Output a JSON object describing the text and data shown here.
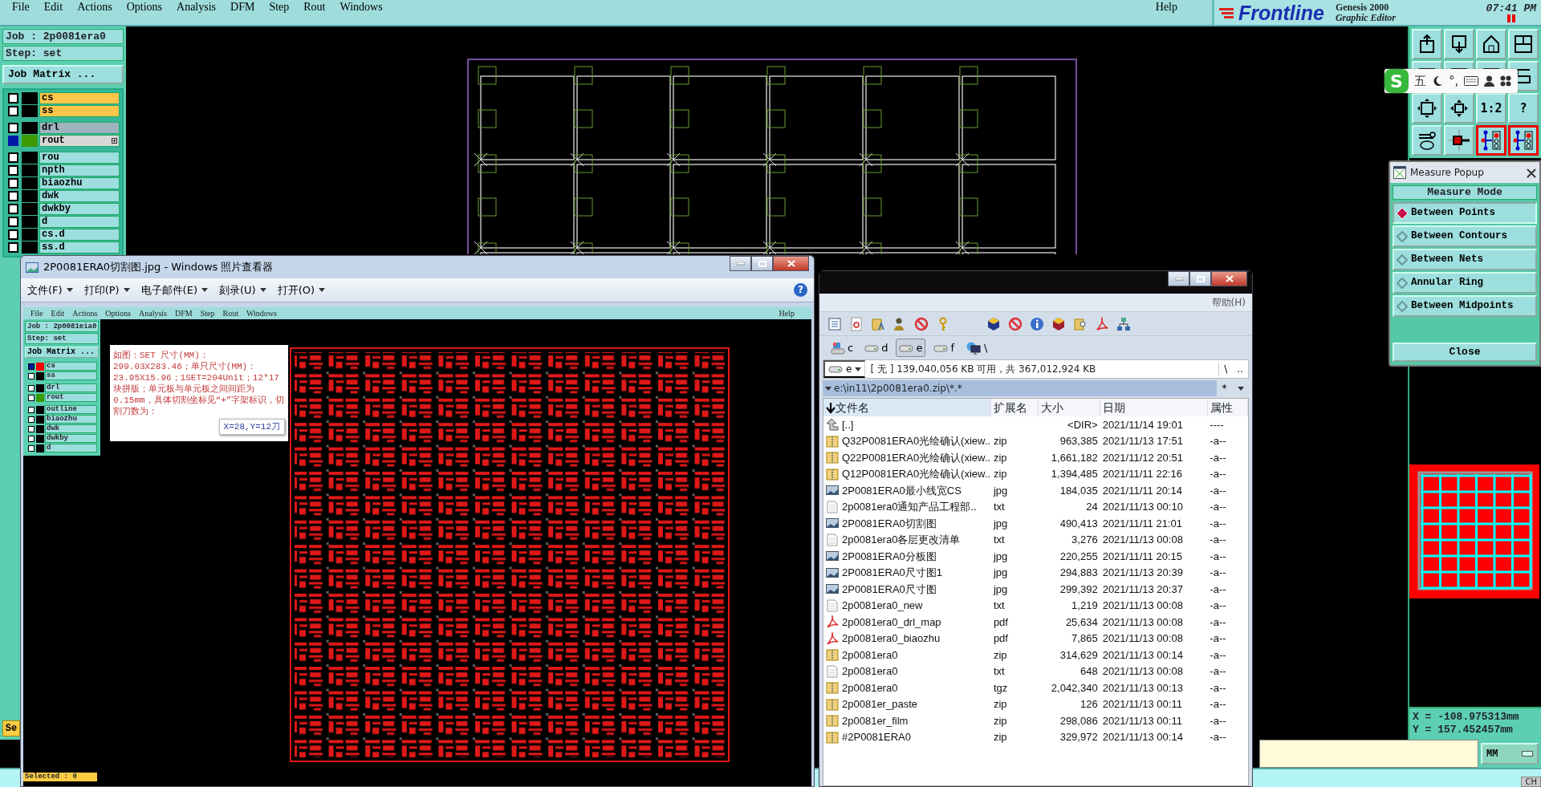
{
  "menu_bar": {
    "items": [
      "File",
      "Edit",
      "Actions",
      "Options",
      "Analysis",
      "DFM",
      "Step",
      "Rout",
      "Windows"
    ],
    "help": "Help"
  },
  "branding": {
    "logo": "Frontline",
    "product": "Genesis 2000",
    "subtitle": "Graphic Editor",
    "time": "07:41 PM"
  },
  "job_panel": {
    "job": "Job : 2p0081era0",
    "step": "Step: set",
    "matrix_button": "Job Matrix ...",
    "partial_button": "Se",
    "layers": [
      {
        "name": "cs",
        "kind": "board",
        "affected": false
      },
      {
        "name": "ss",
        "kind": "board",
        "affected": false
      },
      {
        "name": "drl",
        "kind": "drill",
        "affected": false
      },
      {
        "name": "rout",
        "kind": "rout",
        "affected": true,
        "color": "#3a9a00"
      },
      {
        "name": "rou",
        "kind": "misc",
        "affected": false
      },
      {
        "name": "npth",
        "kind": "misc",
        "affected": false
      },
      {
        "name": "biaozhu",
        "kind": "misc",
        "affected": false
      },
      {
        "name": "dwk",
        "kind": "misc",
        "affected": false
      },
      {
        "name": "dwkby",
        "kind": "misc",
        "affected": false
      },
      {
        "name": "d",
        "kind": "misc",
        "affected": false
      },
      {
        "name": "cs.d",
        "kind": "misc",
        "affected": false
      },
      {
        "name": "ss.d",
        "kind": "misc",
        "affected": false
      }
    ]
  },
  "toolbar": [
    {
      "kind": "upload"
    },
    {
      "kind": "download"
    },
    {
      "kind": "home"
    },
    {
      "kind": "layout"
    },
    {
      "kind": "window"
    },
    {
      "kind": "window"
    },
    {
      "kind": "window"
    },
    {
      "kind": "curve"
    },
    {
      "kind": "fit"
    },
    {
      "kind": "center"
    },
    {
      "kind": "text",
      "label": "1:2"
    },
    {
      "kind": "text",
      "label": "?"
    },
    {
      "kind": "tools"
    },
    {
      "kind": "probe"
    },
    {
      "kind": "netlist"
    },
    {
      "kind": "netlist"
    }
  ],
  "ime_bar": {
    "logo": "S",
    "mode": "五",
    "punct": "°,"
  },
  "measure_popup": {
    "title": "Measure Popup",
    "heading": "Measure Mode",
    "modes": [
      {
        "label": "Between Points",
        "selected": true
      },
      {
        "label": "Between Contours",
        "selected": false
      },
      {
        "label": "Between Nets",
        "selected": false
      },
      {
        "label": "Annular Ring",
        "selected": false
      },
      {
        "label": "Between Midpoints",
        "selected": false
      }
    ],
    "close": "Close"
  },
  "coordinates": {
    "x": "X = -108.975313mm",
    "y": "Y = 157.452457mm"
  },
  "command_line": {
    "unit": "MM"
  },
  "tray": {
    "label": "CH"
  },
  "photo_viewer": {
    "title": "2P0081ERA0切割图.jpg - Windows 照片查看器",
    "menu": [
      "文件(F)",
      "打印(P)",
      "电子邮件(E)",
      "刻录(U)",
      "打开(O)"
    ],
    "help": "?",
    "image": {
      "menu_items": [
        "File",
        "Edit",
        "Actions",
        "Options",
        "Analysis",
        "DFM",
        "Step",
        "Rout",
        "Windows"
      ],
      "help": "Help",
      "job": "Job : 2p0081eia0",
      "step": "Step: set",
      "matrix_button": "Job Matrix ...",
      "layers": [
        {
          "name": "cs",
          "kind": "board",
          "affected": true,
          "color": "#ff0000"
        },
        {
          "name": "ss",
          "kind": "board",
          "affected": false
        },
        {
          "name": "drl",
          "kind": "drill",
          "affected": false
        },
        {
          "name": "rout",
          "kind": "rout",
          "affected": false,
          "color": "#3a9a00"
        },
        {
          "name": "outline",
          "kind": "misc",
          "affected": false
        },
        {
          "name": "biaozhu",
          "kind": "misc",
          "affected": false
        },
        {
          "name": "dwk",
          "kind": "misc",
          "affected": false
        },
        {
          "name": "dwkby",
          "kind": "misc",
          "affected": false
        },
        {
          "name": "d",
          "kind": "misc",
          "affected": false
        }
      ],
      "note": "如图：SET 尺寸(MM)：299.03X283.46；单只尺寸(MM)：23.95X15.96；1SET=204Unit；12*17块拼版；单元板与单元板之间间距为0.15mm，具体切割坐标见“+”字架标识，切割刀数为：",
      "tooltip": "X=28,Y=12刀",
      "status": "Selected : 0"
    }
  },
  "file_manager": {
    "help_menu": "帮助(H)",
    "drives": [
      {
        "label": "c",
        "kind": "system",
        "selected": false
      },
      {
        "label": "d",
        "kind": "local",
        "selected": false
      },
      {
        "label": "e",
        "kind": "local",
        "selected": true
      },
      {
        "label": "f",
        "kind": "local",
        "selected": false
      },
      {
        "label": "\\",
        "kind": "network",
        "selected": false
      }
    ],
    "drive_select": "e",
    "free_space": "[ 无 ] 139,040,056 KB 可用，共 367,012,924 KB",
    "nav": [
      "\\",
      ".."
    ],
    "path": "e:\\in11\\2p0081era0.zip\\*.*",
    "filter": "*",
    "columns": [
      "文件名",
      "扩展名",
      "大小",
      "日期",
      "属性"
    ],
    "files": [
      {
        "kind": "up",
        "name": "[..]",
        "size": "<DIR>",
        "date": "2021/11/14 19:01",
        "attr": "----"
      },
      {
        "kind": "zip",
        "name": "Q32P0081ERA0光绘确认(xiew..",
        "ext": "zip",
        "size": "963,385",
        "date": "2021/11/13 17:51",
        "attr": "-a--"
      },
      {
        "kind": "zip",
        "name": "Q22P0081ERA0光绘确认(xiew..",
        "ext": "zip",
        "size": "1,661,182",
        "date": "2021/11/12 20:51",
        "attr": "-a--"
      },
      {
        "kind": "zip",
        "name": "Q12P0081ERA0光绘确认(xiew..",
        "ext": "zip",
        "size": "1,394,485",
        "date": "2021/11/11 22:16",
        "attr": "-a--"
      },
      {
        "kind": "image",
        "name": "2P0081ERA0最小线宽CS",
        "ext": "jpg",
        "size": "184,035",
        "date": "2021/11/11 20:14",
        "attr": "-a--"
      },
      {
        "kind": "text",
        "name": "2p0081era0通知产品工程部..",
        "ext": "txt",
        "size": "24",
        "date": "2021/11/13 00:10",
        "attr": "-a--"
      },
      {
        "kind": "image",
        "name": "2P0081ERA0切割图",
        "ext": "jpg",
        "size": "490,413",
        "date": "2021/11/11 21:01",
        "attr": "-a--"
      },
      {
        "kind": "text",
        "name": "2p0081era0各层更改清单",
        "ext": "txt",
        "size": "3,276",
        "date": "2021/11/13 00:08",
        "attr": "-a--"
      },
      {
        "kind": "image",
        "name": "2P0081ERA0分板图",
        "ext": "jpg",
        "size": "220,255",
        "date": "2021/11/11 20:15",
        "attr": "-a--"
      },
      {
        "kind": "image",
        "name": "2P0081ERA0尺寸图1",
        "ext": "jpg",
        "size": "294,883",
        "date": "2021/11/13 20:39",
        "attr": "-a--"
      },
      {
        "kind": "image",
        "name": "2P0081ERA0尺寸图",
        "ext": "jpg",
        "size": "299,392",
        "date": "2021/11/13 20:37",
        "attr": "-a--"
      },
      {
        "kind": "text",
        "name": "2p0081era0_new",
        "ext": "txt",
        "size": "1,219",
        "date": "2021/11/13 00:08",
        "attr": "-a--"
      },
      {
        "kind": "pdf",
        "name": "2p0081era0_drl_map",
        "ext": "pdf",
        "size": "25,634",
        "date": "2021/11/13 00:08",
        "attr": "-a--"
      },
      {
        "kind": "pdf",
        "name": "2p0081era0_biaozhu",
        "ext": "pdf",
        "size": "7,865",
        "date": "2021/11/13 00:08",
        "attr": "-a--"
      },
      {
        "kind": "zip",
        "name": "2p0081era0",
        "ext": "zip",
        "size": "314,629",
        "date": "2021/11/13 00:14",
        "attr": "-a--"
      },
      {
        "kind": "text",
        "name": "2p0081era0",
        "ext": "txt",
        "size": "648",
        "date": "2021/11/13 00:08",
        "attr": "-a--"
      },
      {
        "kind": "zip",
        "name": "2p0081era0",
        "ext": "tgz",
        "size": "2,042,340",
        "date": "2021/11/13 00:13",
        "attr": "-a--"
      },
      {
        "kind": "zip",
        "name": "2p0081er_paste",
        "ext": "zip",
        "size": "126",
        "date": "2021/11/13 00:11",
        "attr": "-a--"
      },
      {
        "kind": "zip",
        "name": "2p0081er_film",
        "ext": "zip",
        "size": "298,086",
        "date": "2021/11/13 00:11",
        "attr": "-a--"
      },
      {
        "kind": "zip",
        "name": "#2P0081ERA0",
        "ext": "zip",
        "size": "329,972",
        "date": "2021/11/13 00:14",
        "attr": "-a--"
      }
    ]
  }
}
